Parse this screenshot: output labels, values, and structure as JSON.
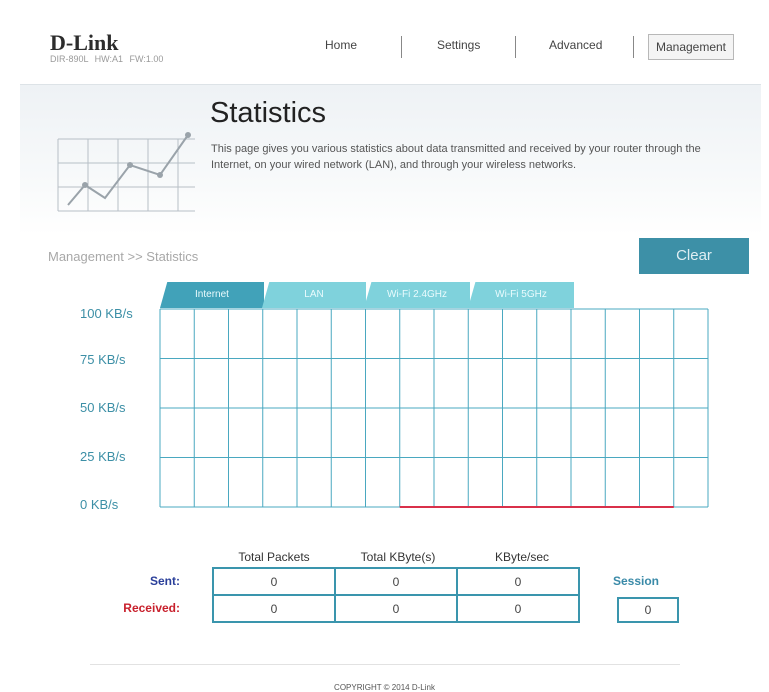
{
  "header": {
    "logo_text": "D-Link",
    "model_info": "DIR-890L HW:A1 FW:1.00",
    "nav": [
      {
        "label": "Home"
      },
      {
        "label": "Settings"
      },
      {
        "label": "Advanced"
      },
      {
        "label": "Management",
        "active": true
      }
    ]
  },
  "banner": {
    "icon": "line-chart-icon",
    "title": "Statistics",
    "description": "This page gives you various statistics about data transmitted and received by your router through the Internet, on your wired network (LAN), and through your wireless networks."
  },
  "breadcrumb": "Management >> Statistics",
  "clear_button": "Clear",
  "tabs": [
    {
      "label": "Internet",
      "active": true
    },
    {
      "label": "LAN"
    },
    {
      "label": "Wi-Fi 2.4GHz"
    },
    {
      "label": "Wi-Fi 5GHz"
    }
  ],
  "chart_data": {
    "type": "line",
    "title": "",
    "xlabel": "",
    "ylabel": "",
    "y_tick_labels": [
      "100 KB/s",
      "75 KB/s",
      "50 KB/s",
      "25 KB/s",
      "0 KB/s"
    ],
    "ylim": [
      0,
      100
    ],
    "unit": "KB/s",
    "grid": true,
    "series": [
      {
        "color": "#d9304a",
        "x": [
          7,
          8,
          9,
          10,
          11,
          12,
          13,
          14,
          15
        ],
        "values": [
          0,
          0,
          0,
          0,
          0,
          0,
          0,
          0,
          0
        ]
      }
    ],
    "x_range": [
      0,
      16
    ]
  },
  "stats": {
    "columns": [
      "Total Packets",
      "Total KByte(s)",
      "KByte/sec"
    ],
    "rows": [
      {
        "label": "Sent:",
        "color": "#2a3f9a",
        "values": [
          "0",
          "0",
          "0"
        ]
      },
      {
        "label": "Received:",
        "color": "#c8202c",
        "values": [
          "0",
          "0",
          "0"
        ]
      }
    ],
    "session_label": "Session",
    "session_value": "0"
  },
  "footer": {
    "copyright": "COPYRIGHT © 2014 D-Link"
  },
  "colors": {
    "accent": "#3d90a7",
    "tab_active": "#41a2b9",
    "tab_inactive": "#7fd2dc",
    "grid": "#4aa8c0"
  }
}
